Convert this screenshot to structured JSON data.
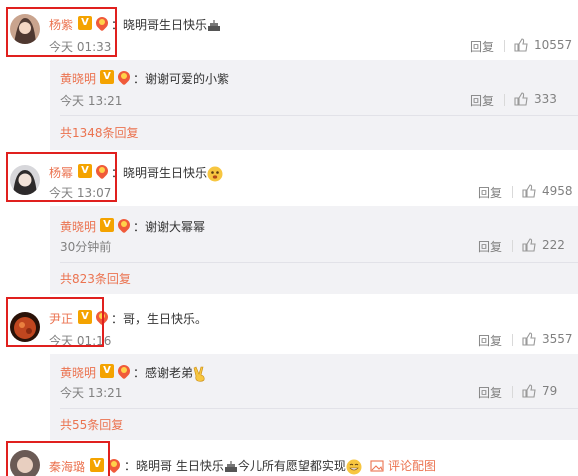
{
  "comments": [
    {
      "author": "杨紫",
      "text": "：晓明哥生日快乐",
      "time": "今天 01:33",
      "reply_label": "回复",
      "likes": "10557",
      "sub": {
        "author": "黄晓明",
        "text": "：谢谢可爱的小紫",
        "time": "今天 13:21",
        "reply_label": "回复",
        "likes": "333"
      },
      "more": "共1348条回复"
    },
    {
      "author": "杨幂",
      "text": "：晓明哥生日快乐",
      "time": "今天 13:07",
      "reply_label": "回复",
      "likes": "4958",
      "sub": {
        "author": "黄晓明",
        "text": "：谢谢大幂幂",
        "time": "30分钟前",
        "reply_label": "回复",
        "likes": "222"
      },
      "more": "共823条回复"
    },
    {
      "author": "尹正",
      "text": "：哥，生日快乐。",
      "time": "今天 01:16",
      "reply_label": "回复",
      "likes": "3557",
      "sub": {
        "author": "黄晓明",
        "text": "：感谢老弟",
        "time": "今天 13:21",
        "reply_label": "回复",
        "likes": "79"
      },
      "more": "共55条回复"
    },
    {
      "author": "秦海璐",
      "text": "：晓明哥 生日快乐",
      "text2": "今儿所有愿望都实现",
      "comment_image": "评论配图"
    }
  ],
  "badge_v": "V",
  "colors": {
    "name": "#eb7350",
    "highlight": "#e0201e",
    "badge": "#f4a300",
    "subbox": "#f2f2f5"
  },
  "icons": [
    "thumb-up-icon",
    "cake-icon",
    "smile-emoji-icon",
    "victory-hand-icon",
    "image-icon",
    "v-badge-icon",
    "heart-medal-icon"
  ]
}
